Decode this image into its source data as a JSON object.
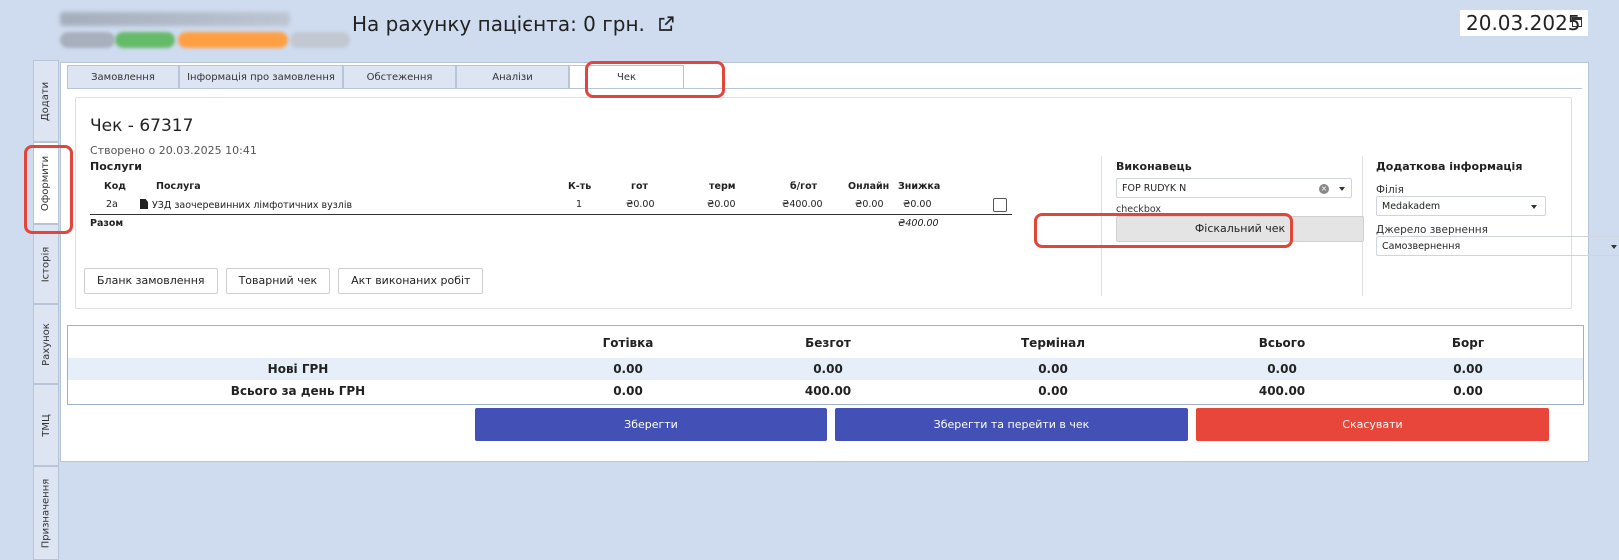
{
  "header": {
    "account_label": "На рахунку пацієнта: 0 грн.",
    "date": "20.03.2025"
  },
  "left_tabs": [
    "Додати",
    "Оформити",
    "Історія",
    "Рахунок",
    "ТМЦ",
    "Призначення"
  ],
  "top_tabs": [
    "Замовлення",
    "Інформація про замовлення",
    "Обстеження",
    "Аналізи",
    "Чек"
  ],
  "check": {
    "title": "Чек - 67317",
    "created": "Створено о 20.03.2025 10:41",
    "services_title": "Послуги",
    "columns": {
      "code": "Код",
      "service": "Послуга",
      "qty": "К-ть",
      "cash": "гот",
      "terminal": "терм",
      "noncash": "б/гот",
      "online": "Онлайн",
      "discount": "Знижка"
    },
    "rows": [
      {
        "code": "2а",
        "service": "УЗД заочеревинних лімфотичних вузлів",
        "qty": "1",
        "cash": "₴0.00",
        "terminal": "₴0.00",
        "noncash": "₴400.00",
        "online": "₴0.00",
        "discount": "₴0.00"
      }
    ],
    "total_label": "Разом",
    "total_value": "₴400.00"
  },
  "executor": {
    "title": "Виконавець",
    "value": "FOP RUDYK N",
    "checkbox_label": "checkbox",
    "fiscal_button": "Фіскальний чек"
  },
  "additional": {
    "title": "Додаткова інформація",
    "branch_label": "Філія",
    "branch_value": "Medakadem",
    "source_label": "Джерело звернення",
    "source_value": "Самозвернення"
  },
  "doc_buttons": [
    "Бланк замовлення",
    "Товарний чек",
    "Акт виконаних робіт"
  ],
  "totals": {
    "headers": [
      "Готівка",
      "Безгот",
      "Термінал",
      "Всього",
      "Борг"
    ],
    "rows": [
      {
        "label": "Нові ГРН",
        "values": [
          "0.00",
          "0.00",
          "0.00",
          "0.00",
          "0.00"
        ]
      },
      {
        "label": "Всього за день ГРН",
        "values": [
          "0.00",
          "400.00",
          "0.00",
          "400.00",
          "0.00"
        ]
      }
    ]
  },
  "actions": {
    "save": "Зберегти",
    "save_go": "Зберегти та перейти в чек",
    "cancel": "Скасувати"
  },
  "colors": {
    "primary": "#4350b5",
    "danger": "#e8463b",
    "highlight": "#e2463b",
    "background": "#cfdbef"
  }
}
